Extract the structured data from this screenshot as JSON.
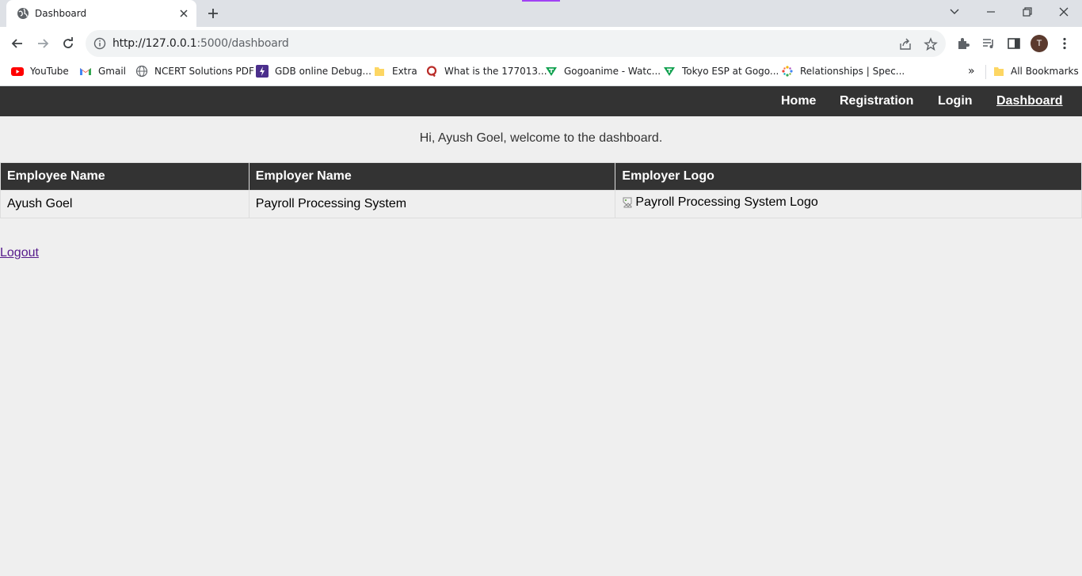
{
  "browser": {
    "tab_title": "Dashboard",
    "url_host": "http://127.0.0.1",
    "url_path": ":5000/dashboard",
    "profile_initial": "T",
    "bookmarks": [
      {
        "label": "YouTube",
        "icon": "youtube-icon"
      },
      {
        "label": "Gmail",
        "icon": "gmail-icon"
      },
      {
        "label": "NCERT Solutions PDF",
        "icon": "globe-icon"
      },
      {
        "label": "GDB online Debug...",
        "icon": "gdb-icon"
      },
      {
        "label": "Extra",
        "icon": "folder-icon"
      },
      {
        "label": "What is the 177013...",
        "icon": "quora-icon"
      },
      {
        "label": "Gogoanime - Watc...",
        "icon": "gogoanime-icon"
      },
      {
        "label": "Tokyo ESP at Gogo...",
        "icon": "gogoanime-icon"
      },
      {
        "label": "Relationships | Spec...",
        "icon": "spectrum-icon"
      }
    ],
    "overflow_label": "»",
    "all_bookmarks": "All Bookmarks"
  },
  "nav": {
    "links": [
      "Home",
      "Registration",
      "Login",
      "Dashboard"
    ],
    "active": "Dashboard"
  },
  "welcome": "Hi, Ayush Goel, welcome to the dashboard.",
  "table": {
    "headers": [
      "Employee Name",
      "Employer Name",
      "Employer Logo"
    ],
    "rows": [
      [
        "Ayush Goel",
        "Payroll Processing System",
        "Payroll Processing System Logo"
      ]
    ]
  },
  "logout_label": "Logout",
  "colors": {
    "navbar": "#333333",
    "page_bg": "#efefef",
    "link_visited": "#551a8b"
  }
}
